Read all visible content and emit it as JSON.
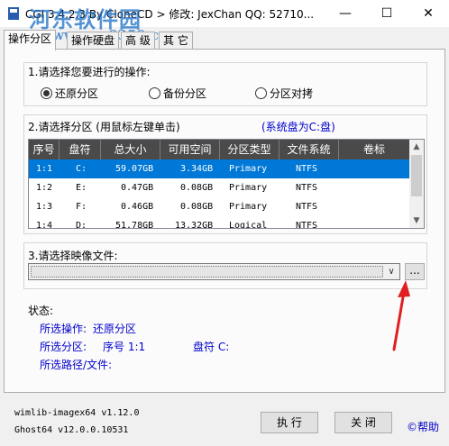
{
  "window": {
    "title": "CGI 3.4.2.3 By CloneCD > 修改: JexChan  QQ: 52710...",
    "minimize_glyph": "—",
    "maximize_glyph": "☐",
    "close_glyph": "✕",
    "icon": "app-icon"
  },
  "watermark": {
    "line1": "河东软件园",
    "line2": "www.pc0359.cn"
  },
  "tabs": [
    "操作分区",
    "操作硬盘",
    "高 级",
    "其 它"
  ],
  "active_tab": 0,
  "section1": {
    "label": "1.请选择您要进行的操作:",
    "options": [
      "还原分区",
      "备份分区",
      "分区对拷"
    ],
    "selected": 0
  },
  "section2": {
    "label": "2.请选择分区 (用鼠标左键单击)",
    "system_disk": "(系统盘为C:盘)",
    "columns": [
      "序号",
      "盘符",
      "总大小",
      "可用空间",
      "分区类型",
      "文件系统",
      "卷标"
    ],
    "rows": [
      [
        "1:1",
        "C:",
        "59.07GB",
        "3.34GB",
        "Primary",
        "NTFS",
        ""
      ],
      [
        "1:2",
        "E:",
        "0.47GB",
        "0.08GB",
        "Primary",
        "NTFS",
        ""
      ],
      [
        "1:3",
        "F:",
        "0.46GB",
        "0.08GB",
        "Primary",
        "NTFS",
        ""
      ],
      [
        "1:4",
        "D:",
        "51.78GB",
        "13.32GB",
        "Logical",
        "NTFS",
        ""
      ]
    ],
    "selected_row": 0,
    "scroll_up_glyph": "▲",
    "scroll_down_glyph": "▼"
  },
  "section3": {
    "label": "3.请选择映像文件:",
    "value": "",
    "dropdown_glyph": "∨",
    "browse_label": "..."
  },
  "status": {
    "label": "状态:",
    "op_label": "所选操作:",
    "op_value": "还原分区",
    "part_label": "所选分区:",
    "part_value": "序号 1:1",
    "drive_label": "盘符 C:",
    "path_label": "所选路径/文件:"
  },
  "footer": {
    "line1": "wimlib-imagex64 v1.12.0",
    "line2": "Ghost64 v12.0.0.10531",
    "execute_label": "执 行",
    "close_label": "关 闭",
    "help_label": "©帮助"
  },
  "colors": {
    "selection": "#0078d7",
    "header_bg": "#4a4a4a",
    "link_blue": "#0000cc",
    "arrow_red": "#e02020"
  }
}
